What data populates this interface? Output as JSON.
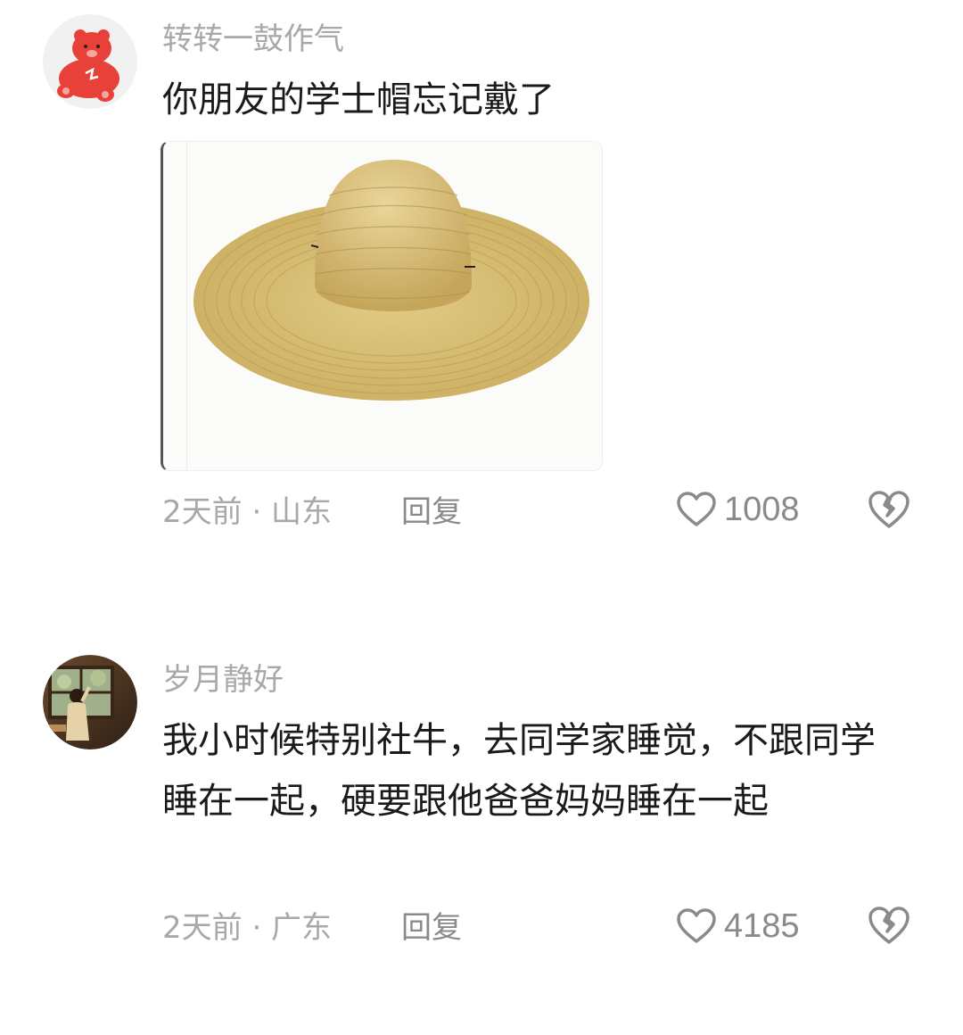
{
  "comments": [
    {
      "username": "转转一鼓作气",
      "text": "你朋友的学士帽忘记戴了",
      "meta": "2天前 · 山东",
      "reply": "回复",
      "likes": "1008",
      "avatar_icon": "red-bear-avatar",
      "image_icon": "straw-hat-image"
    },
    {
      "username": "岁月静好",
      "text": "我小时候特别社牛，去同学家睡觉，不跟同学睡在一起，硬要跟他爸爸妈妈睡在一起",
      "meta": "2天前 · 广东",
      "reply": "回复",
      "likes": "4185",
      "avatar_icon": "girl-by-window-avatar"
    }
  ],
  "colors": {
    "username": "#a8a8a8",
    "text": "#1a1a1a",
    "meta": "#a8a8a8",
    "icon": "#8a8a8a",
    "bear": "#e8413a",
    "hat": "#d9c27a"
  }
}
